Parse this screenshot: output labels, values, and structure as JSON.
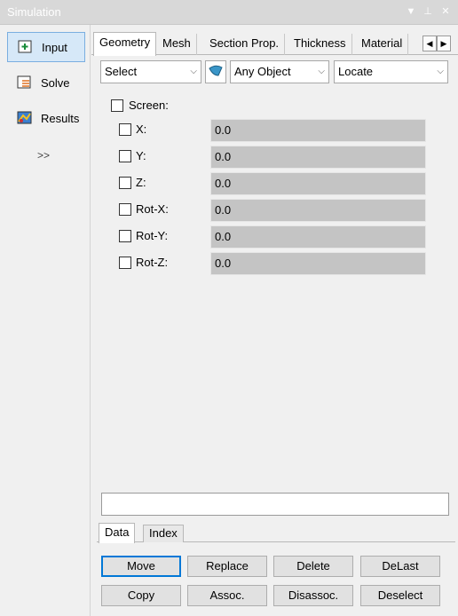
{
  "window": {
    "title": "Simulation",
    "caption_icons": [
      "dropdown-icon",
      "pin-icon",
      "close-icon"
    ]
  },
  "nav": {
    "items": [
      {
        "label": "Input",
        "icon": "input-icon"
      },
      {
        "label": "Solve",
        "icon": "solve-icon"
      },
      {
        "label": "Results",
        "icon": "results-icon"
      }
    ],
    "more_label": ">>"
  },
  "tabs": [
    "Geometry",
    "Mesh",
    "Section Prop.",
    "Thickness",
    "Material"
  ],
  "toolbar": {
    "select": "Select",
    "object_filter": "Any Object",
    "locate": "Locate"
  },
  "screen_label": "Screen:",
  "fields": [
    {
      "label": "X:",
      "value": "0.0"
    },
    {
      "label": "Y:",
      "value": "0.0"
    },
    {
      "label": "Z:",
      "value": "0.0"
    },
    {
      "label": "Rot-X:",
      "value": "0.0"
    },
    {
      "label": "Rot-Y:",
      "value": "0.0"
    },
    {
      "label": "Rot-Z:",
      "value": "0.0"
    }
  ],
  "bottom_tabs": [
    "Data",
    "Index"
  ],
  "buttons": {
    "move": "Move",
    "replace": "Replace",
    "delete": "Delete",
    "delast": "DeLast",
    "copy": "Copy",
    "assoc": "Assoc.",
    "disassoc": "Disassoc.",
    "deselect": "Deselect"
  }
}
